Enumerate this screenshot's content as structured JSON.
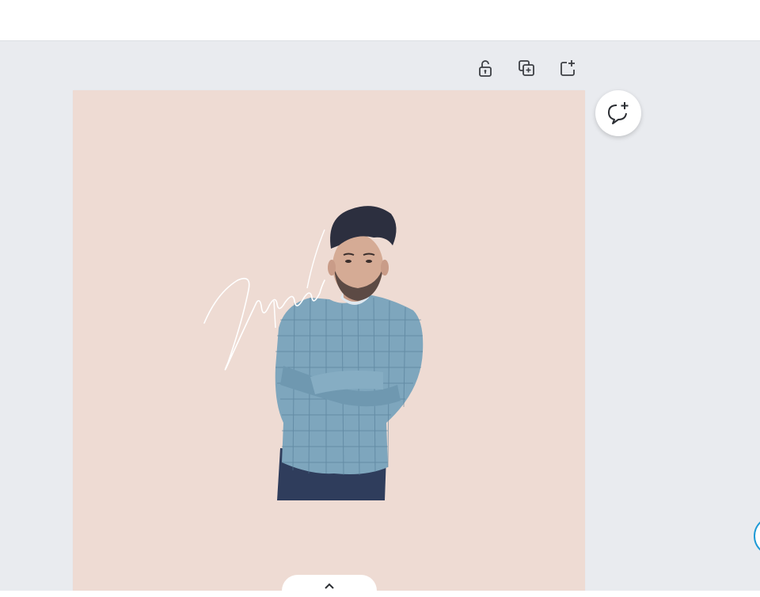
{
  "colors": {
    "canvas_background": "#eedbd3",
    "workspace_background": "#e9ebef",
    "toolbar_background": "#ffffff",
    "icon_color": "#3c3f44",
    "accent_blue": "#1e9ad6"
  },
  "page_toolbar": {
    "icons": [
      "unlock-icon",
      "duplicate-page-icon",
      "add-page-icon"
    ]
  },
  "comment_button": {
    "icon": "comment-add-icon"
  },
  "canvas": {
    "signature_text": "Gurpreet",
    "image_subject": "man-in-plaid-shirt"
  },
  "pages_toggle": {
    "icon": "chevron-up-icon"
  }
}
